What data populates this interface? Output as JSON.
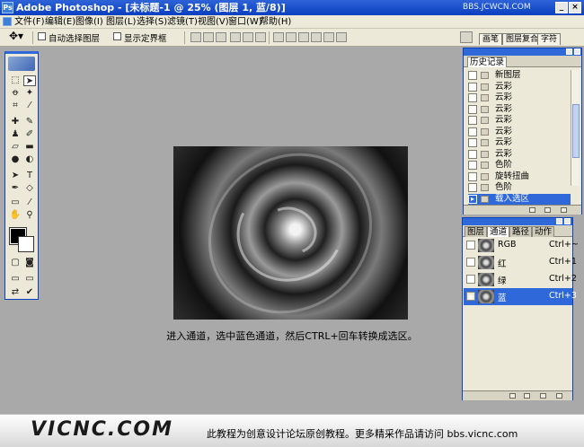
{
  "window": {
    "title": "Adobe Photoshop - [未标题-1 @ 25% (图层 1, 蓝/8)]",
    "icon": "photoshop-icon",
    "watermark": "BBS.JCWCN.COM"
  },
  "menu": [
    "文件(F)",
    "编辑(E)",
    "图像(I)",
    "图层(L)",
    "选择(S)",
    "滤镜(T)",
    "视图(V)",
    "窗口(W)",
    "帮助(H)"
  ],
  "options": {
    "auto_select": "自动选择图层",
    "show_bounds": "显示定界框"
  },
  "palette_well": [
    "画笔",
    "图层复合",
    "字符"
  ],
  "history": {
    "tab": "历史记录",
    "items": [
      "新图层",
      "云彩",
      "云彩",
      "云彩",
      "云彩",
      "云彩",
      "云彩",
      "云彩",
      "色阶",
      "旋转扭曲",
      "色阶",
      "载入选区"
    ],
    "selected_index": 11
  },
  "channels": {
    "tabs": [
      "图层",
      "通道",
      "路径",
      "动作"
    ],
    "active_tab": 1,
    "rows": [
      {
        "name": "RGB",
        "shortcut": "Ctrl+~"
      },
      {
        "name": "红",
        "shortcut": "Ctrl+1"
      },
      {
        "name": "绿",
        "shortcut": "Ctrl+2"
      },
      {
        "name": "蓝",
        "shortcut": "Ctrl+3"
      }
    ],
    "selected_index": 3
  },
  "instruction": "进入通道，选中蓝色通道，然后CTRL+回车转换成选区。",
  "footer": {
    "logo": "VICNC.COM",
    "text": "此教程为创意设计论坛原创教程。更多精采作品请访问 bbs.vicnc.com"
  },
  "colors": {
    "title_blue": "#0a3fc0",
    "selection_blue": "#2f68d9",
    "chrome": "#ece9d8",
    "workspace": "#a9a9a9"
  }
}
